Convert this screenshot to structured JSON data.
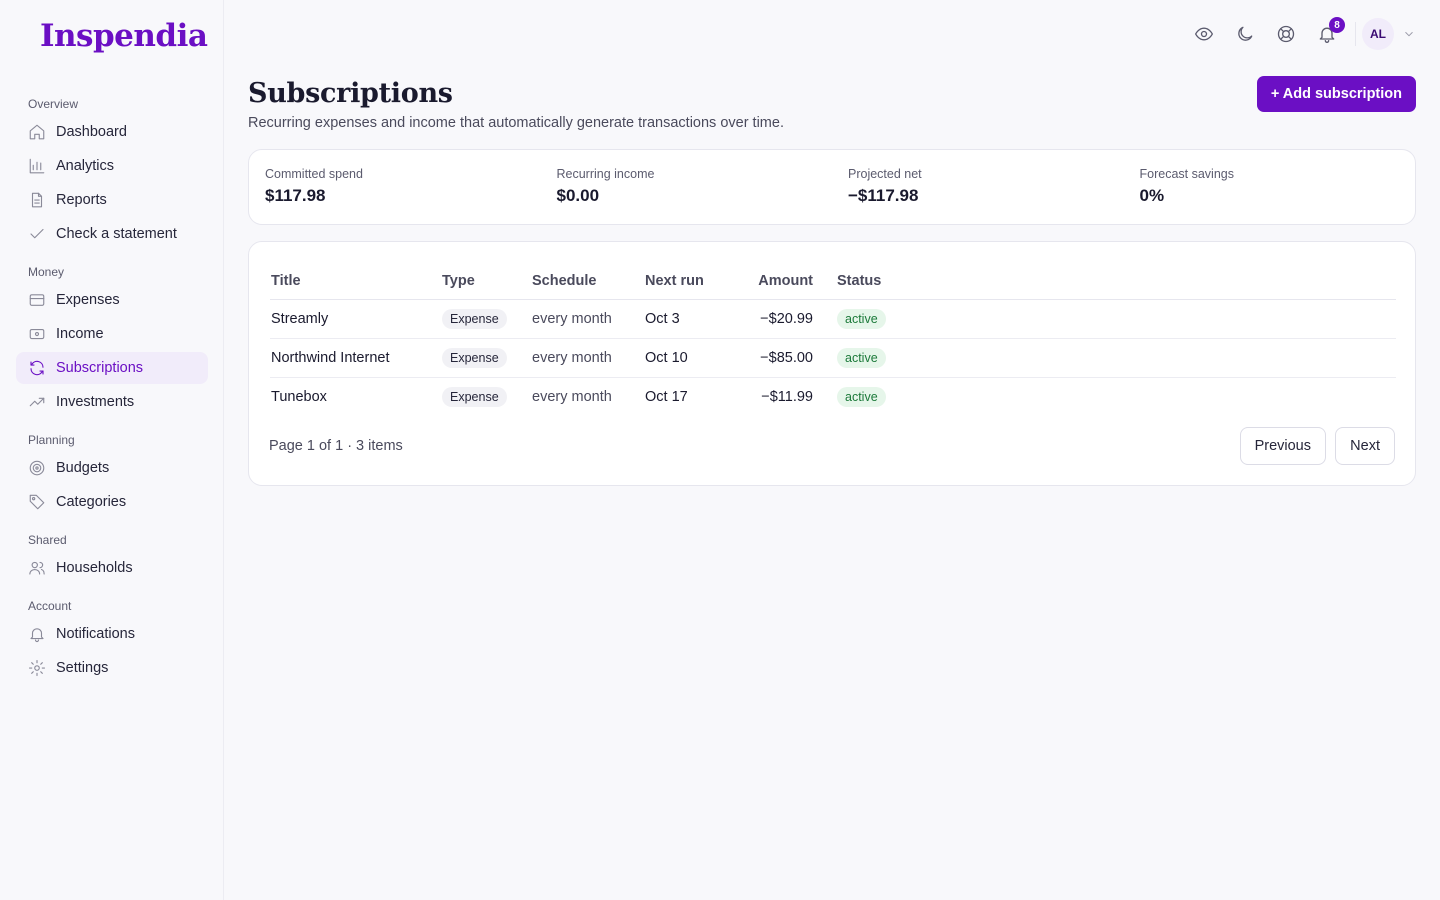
{
  "app": {
    "logo": "Inspendia"
  },
  "sidebar": {
    "sections": [
      {
        "heading": "Overview",
        "items": [
          {
            "label": "Dashboard",
            "icon": "home-icon"
          },
          {
            "label": "Analytics",
            "icon": "bar-chart-icon"
          },
          {
            "label": "Reports",
            "icon": "document-icon"
          },
          {
            "label": "Check a statement",
            "icon": "check-icon"
          }
        ]
      },
      {
        "heading": "Money",
        "items": [
          {
            "label": "Expenses",
            "icon": "credit-card-icon"
          },
          {
            "label": "Income",
            "icon": "banknote-icon"
          },
          {
            "label": "Subscriptions",
            "icon": "refresh-icon",
            "active": true
          },
          {
            "label": "Investments",
            "icon": "trending-up-icon"
          }
        ]
      },
      {
        "heading": "Planning",
        "items": [
          {
            "label": "Budgets",
            "icon": "target-icon"
          },
          {
            "label": "Categories",
            "icon": "tag-icon"
          }
        ]
      },
      {
        "heading": "Shared",
        "items": [
          {
            "label": "Households",
            "icon": "users-icon"
          }
        ]
      },
      {
        "heading": "Account",
        "items": [
          {
            "label": "Notifications",
            "icon": "bell-icon"
          },
          {
            "label": "Settings",
            "icon": "gear-icon"
          }
        ]
      }
    ]
  },
  "topbar": {
    "notification_count": "8",
    "avatar_initials": "AL"
  },
  "page": {
    "title": "Subscriptions",
    "subtitle": "Recurring expenses and income that automatically generate transactions over time.",
    "add_button": "+ Add subscription"
  },
  "stats": [
    {
      "label": "Committed spend",
      "value": "$117.98"
    },
    {
      "label": "Recurring income",
      "value": "$0.00"
    },
    {
      "label": "Projected net",
      "value": "−$117.98"
    },
    {
      "label": "Forecast savings",
      "value": "0%"
    }
  ],
  "table": {
    "columns": [
      "Title",
      "Type",
      "Schedule",
      "Next run",
      "Amount",
      "Status"
    ],
    "rows": [
      {
        "title": "Streamly",
        "type": "Expense",
        "schedule": "every month",
        "next_run": "Oct 3",
        "amount": "−$20.99",
        "status": "active"
      },
      {
        "title": "Northwind Internet",
        "type": "Expense",
        "schedule": "every month",
        "next_run": "Oct 10",
        "amount": "−$85.00",
        "status": "active"
      },
      {
        "title": "Tunebox",
        "type": "Expense",
        "schedule": "every month",
        "next_run": "Oct 17",
        "amount": "−$11.99",
        "status": "active"
      }
    ]
  },
  "pagination": {
    "summary": "Page 1 of 1 · 3 items",
    "previous": "Previous",
    "next": "Next"
  },
  "colors": {
    "brand": "#6b0fc4",
    "active_nav_bg": "#f1ecfa",
    "status_active_bg": "#e6f6ea",
    "status_active_text": "#1c7a3a"
  }
}
